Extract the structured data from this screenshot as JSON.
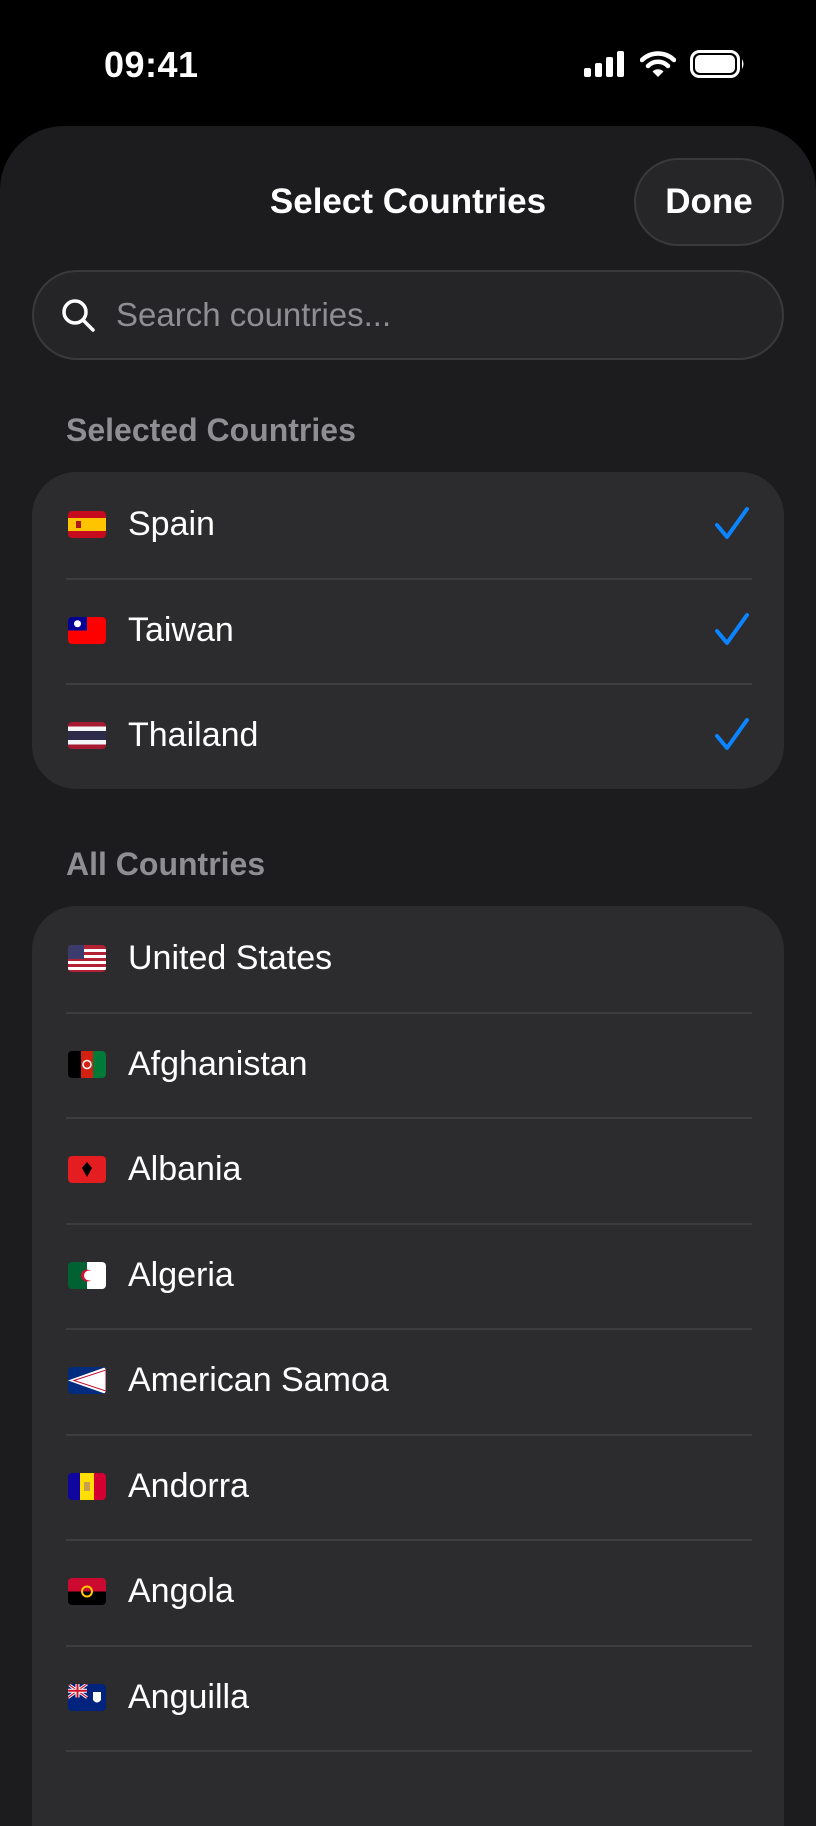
{
  "status_bar": {
    "time": "09:41"
  },
  "header": {
    "title": "Select Countries",
    "done_label": "Done"
  },
  "search": {
    "placeholder": "Search countries..."
  },
  "selected_section": {
    "header": "Selected Countries",
    "items": [
      {
        "name": "Spain",
        "flag": "spain-flag-icon",
        "selected": true
      },
      {
        "name": "Taiwan",
        "flag": "taiwan-flag-icon",
        "selected": true
      },
      {
        "name": "Thailand",
        "flag": "thailand-flag-icon",
        "selected": true
      }
    ]
  },
  "all_section": {
    "header": "All Countries",
    "items": [
      {
        "name": "United States",
        "flag": "united-states-flag-icon"
      },
      {
        "name": "Afghanistan",
        "flag": "afghanistan-flag-icon"
      },
      {
        "name": "Albania",
        "flag": "albania-flag-icon"
      },
      {
        "name": "Algeria",
        "flag": "algeria-flag-icon"
      },
      {
        "name": "American Samoa",
        "flag": "american-samoa-flag-icon"
      },
      {
        "name": "Andorra",
        "flag": "andorra-flag-icon"
      },
      {
        "name": "Angola",
        "flag": "angola-flag-icon"
      },
      {
        "name": "Anguilla",
        "flag": "anguilla-flag-icon"
      }
    ]
  },
  "colors": {
    "background": "#1c1c1e",
    "card": "#2c2c2e",
    "accent_check": "#0a84ff",
    "secondary_text": "#8e8e93"
  }
}
